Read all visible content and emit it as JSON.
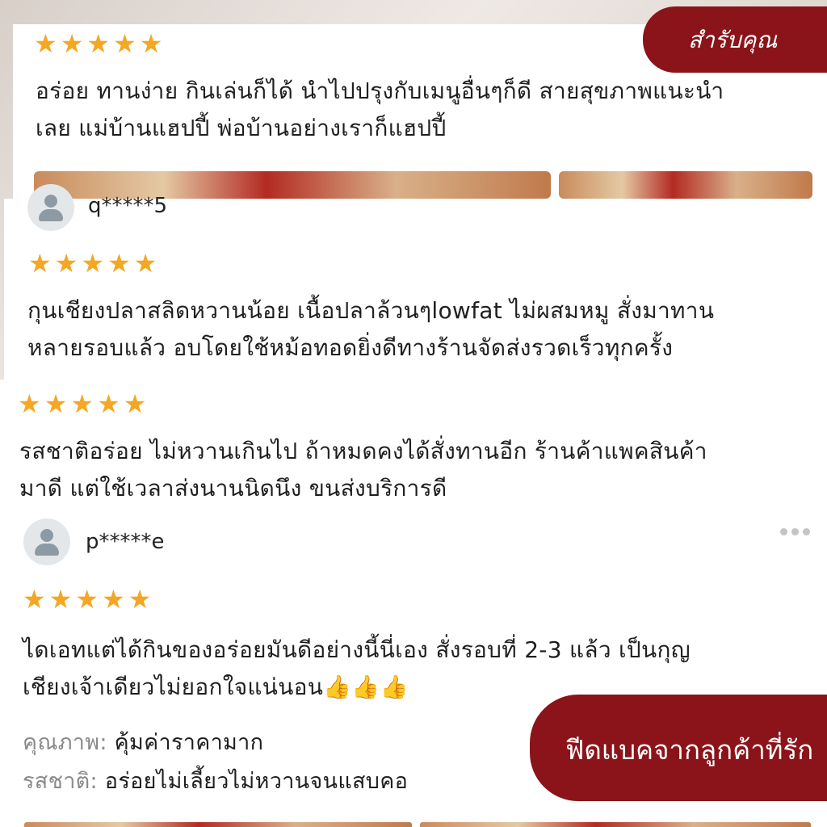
{
  "brand": {
    "name": "สำรับคุณ"
  },
  "reviews": [
    {
      "username": "",
      "stars": [
        "★",
        "★",
        "★",
        "★",
        "★"
      ],
      "lines": [
        "อร่อย ทานง่าย กินเล่นก็ได้ นำไปปรุงกับเมนูอื่นๆก็ดี สายสุขภาพแนะนำ",
        "เลย แม่บ้านแฮปปี้ พ่อบ้านอย่างเราก็แฮปปี้"
      ]
    },
    {
      "username": "q*****5",
      "stars": [
        "★",
        "★",
        "★",
        "★",
        "★"
      ],
      "lines": [
        "กุนเชียงปลาสลิดหวานน้อย เนื้อปลาล้วนๆlowfat ไม่ผสมหมู สั่งมาทาน",
        "หลายรอบแล้ว อบโดยใช้หม้อทอดยิ่งดีทางร้านจัดส่งรวดเร็วทุกครั้ง"
      ]
    },
    {
      "username": "",
      "stars": [
        "★",
        "★",
        "★",
        "★",
        "★"
      ],
      "lines": [
        "รสชาติอร่อย ไม่หวานเกินไป ถ้าหมดคงได้สั่งทานอีก ร้านค้าแพคสินค้า",
        "มาดี แต่ใช้เวลาส่งนานนิดนึง ขนส่งบริการดี"
      ]
    },
    {
      "username": "p*****e",
      "stars": [
        "★",
        "★",
        "★",
        "★",
        "★"
      ],
      "lines": [
        "ไดเอทแต่ได้กินของอร่อยมันดีอย่างนี้นี่เอง  สั่งรอบที่ 2-3 แล้ว  เป็นกุญ",
        "เชียงเจ้าเดียวไม่ยอกใจแน่นอน👍👍👍"
      ],
      "attributes": [
        {
          "label": "คุณภาพ:",
          "value": "คุ้มค่าราคามาก"
        },
        {
          "label": "รสชาติ:",
          "value": "อร่อยไม่เลี้ยวไม่หวานจนแสบคอ"
        }
      ]
    }
  ],
  "banner": {
    "text": "ฟีดแบคจากลูกค้าที่รัก"
  },
  "colors": {
    "brand": "#8a1419",
    "star": "#f5a623",
    "text": "#1f1f1f",
    "muted": "#8a8a8a"
  },
  "icons": {
    "avatar": "user-avatar-icon",
    "more": "more-dots-icon",
    "star": "star-icon"
  }
}
